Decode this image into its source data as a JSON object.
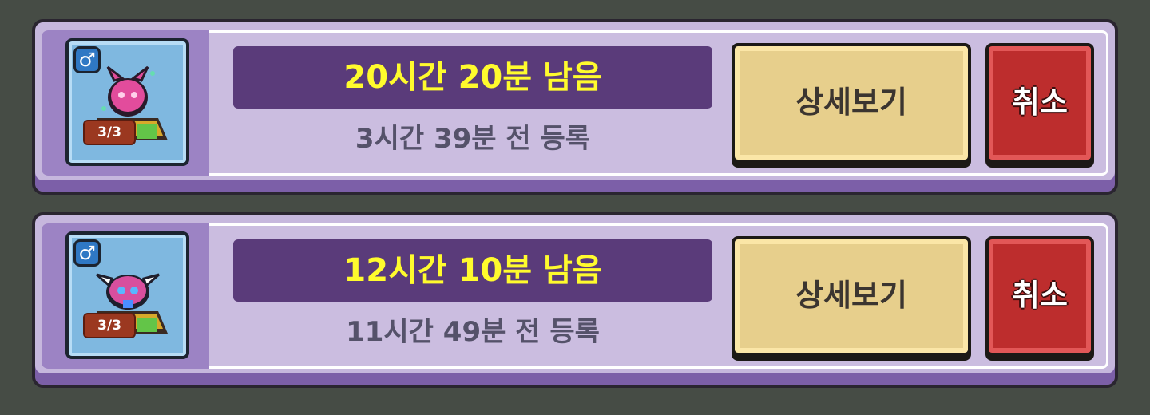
{
  "listings": [
    {
      "gender_symbol": "♂",
      "count": "3/3",
      "time_left": "20시간 20분 남음",
      "registered": "3시간 39분 전 등록",
      "detail_label": "상세보기",
      "cancel_label": "취소",
      "monster_color": "#e24c9c"
    },
    {
      "gender_symbol": "♂",
      "count": "3/3",
      "time_left": "12시간 10분 남음",
      "registered": "11시간 49분 전 등록",
      "detail_label": "상세보기",
      "cancel_label": "취소",
      "monster_color": "#d84f9e"
    }
  ],
  "colors": {
    "background": "#464c45",
    "panel": "#c6b7dd",
    "time_bar": "#5a3b7a",
    "time_text": "#fffb2d",
    "detail_button": "#e7cf8c",
    "cancel_button": "#bd2d2d"
  }
}
